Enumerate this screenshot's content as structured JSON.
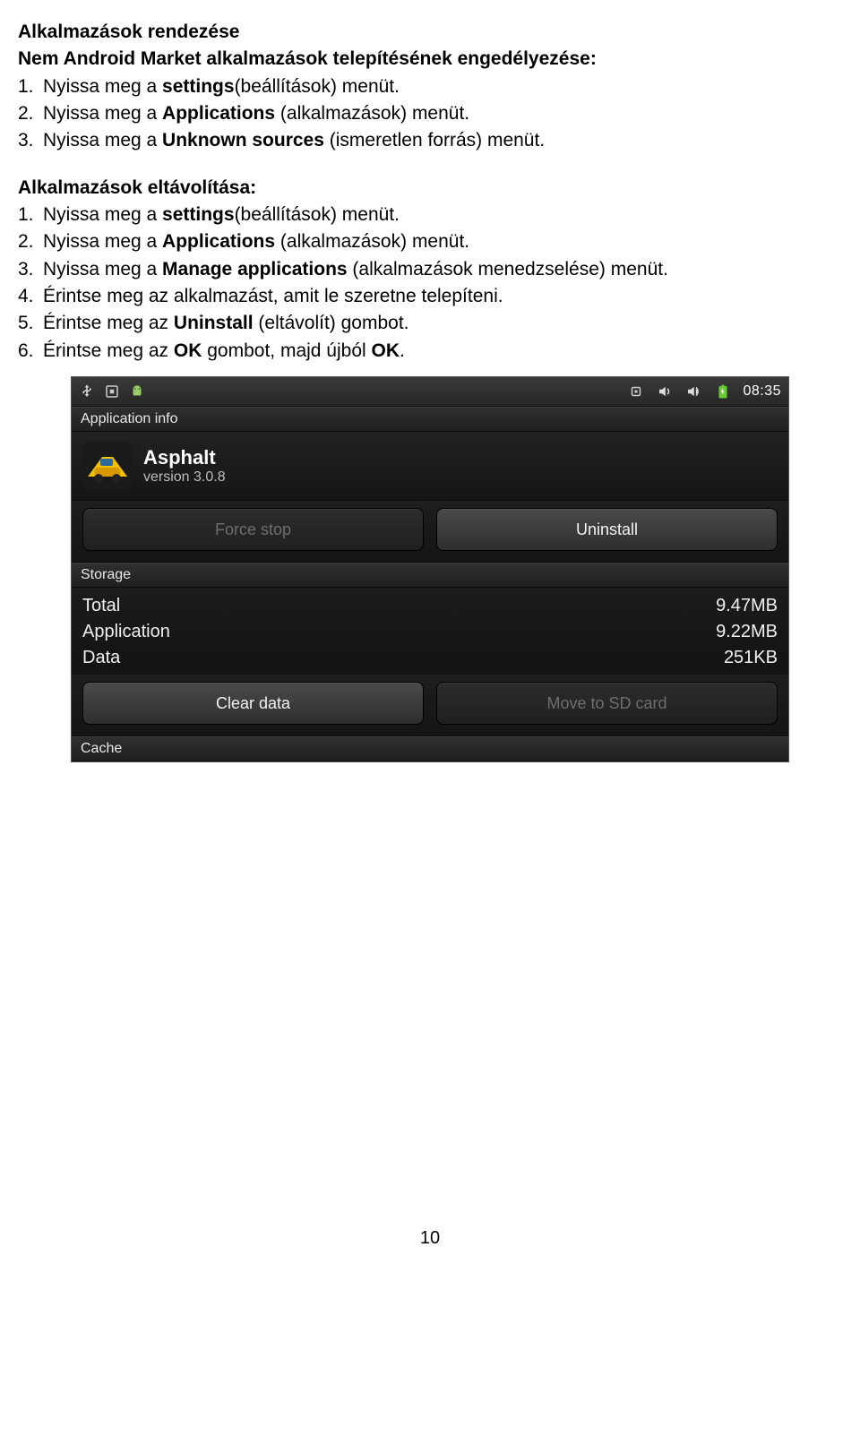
{
  "doc": {
    "h1": "Alkalmazások rendezése",
    "h2": "Nem Android Market alkalmazások telepítésének engedélyezése:",
    "install": [
      {
        "pre": "Nyissa meg a ",
        "bold": "settings",
        "post": "(beállítások) menüt."
      },
      {
        "pre": "Nyissa meg a ",
        "bold": "Applications",
        "post": " (alkalmazások) menüt."
      },
      {
        "pre": "Nyissa meg a ",
        "bold": "Unknown sources",
        "post": " (ismeretlen forrás) menüt."
      }
    ],
    "h3": "Alkalmazások eltávolítása:",
    "remove": [
      {
        "pre": "Nyissa meg a ",
        "bold": "settings",
        "post": "(beállítások) menüt."
      },
      {
        "pre": "Nyissa meg a ",
        "bold": "Applications",
        "post": " (alkalmazások) menüt."
      },
      {
        "pre": "Nyissa meg a ",
        "bold": "Manage applications",
        "post": " (alkalmazások menedzselése) menüt."
      },
      {
        "pre": "Érintse meg az alkalmazást, amit le szeretne telepíteni.",
        "bold": "",
        "post": ""
      },
      {
        "pre": "Érintse meg az ",
        "bold": "Uninstall",
        "post": " (eltávolít) gombot."
      },
      {
        "pre": "Érintse meg az ",
        "bold": "OK",
        "post": " gombot, majd újból ",
        "bold2": "OK",
        "post2": "."
      }
    ],
    "pagenum": "10"
  },
  "android": {
    "clock": "08:35",
    "header_app_info": "Application info",
    "app_name": "Asphalt",
    "app_version": "version 3.0.8",
    "btn_force_stop": "Force stop",
    "btn_uninstall": "Uninstall",
    "header_storage": "Storage",
    "rows": [
      {
        "k": "Total",
        "v": "9.47MB"
      },
      {
        "k": "Application",
        "v": "9.22MB"
      },
      {
        "k": "Data",
        "v": "251KB"
      }
    ],
    "btn_clear_data": "Clear data",
    "btn_move_sd": "Move to SD card",
    "header_cache": "Cache"
  }
}
